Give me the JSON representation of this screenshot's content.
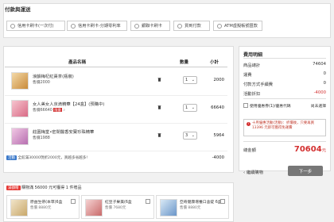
{
  "payment": {
    "title": "付款與運送",
    "options": [
      "信用卡刷卡(一次付)",
      "信用卡刷卡-分期零利率",
      "銀聯卡刷卡",
      "貨到付款",
      "ATM虛擬帳號匯款"
    ]
  },
  "table": {
    "headers": [
      "產品名稱",
      "數量",
      "小計"
    ]
  },
  "items": [
    {
      "name": "浪韻梅杞紅棗茶(瓶裝)",
      "info": "售價2000",
      "qty": "1",
      "subtotal": "2000",
      "tag": ""
    },
    {
      "name": "女人美女人京滴精華【24盒】(預購中)",
      "info": "售價66640",
      "qty": "1",
      "subtotal": "66640",
      "tag": "限量"
    },
    {
      "name": "莊園梅堂•密閉醫香安寶珍珠精華",
      "info": "售價1988",
      "qty": "3",
      "subtotal": "5964",
      "tag": ""
    }
  ],
  "promo_row": {
    "badge": "活動",
    "text": "全館滿30000現折2000元，買越多省越多!",
    "amount": "-4000"
  },
  "fee": {
    "title": "費用明細",
    "lines": [
      {
        "label": "商品總計",
        "value": "74604"
      },
      {
        "label": "運費",
        "value": "0"
      },
      {
        "label": "付款方式手續費",
        "value": "0"
      },
      {
        "label": "活動折扣",
        "value": "-4000"
      }
    ],
    "coupon_label": "使用優惠券(1)/優惠代碼",
    "coupon_link": "尚未選擇",
    "notice": "十月優惠活動(活動)：折價後，只要再買 13396 元即可獲得免運費",
    "total_label": "總金額",
    "total_value": "70604",
    "total_unit": "元"
  },
  "buttons": {
    "back": "繼續購物",
    "next": "下一步"
  },
  "bottom_promo": {
    "badge": "滿額贈",
    "title": "購物滿 56000 元可獲得 1 件贈品",
    "cards": [
      {
        "name": "原益生帶(本草)6盒",
        "price": "售價 8880元"
      },
      {
        "name": "紅豆子果美(6盒",
        "price": "售價 7680元"
      },
      {
        "name": "亞奇健康增養口含錠 6盒",
        "price": "售價 8880元"
      }
    ]
  },
  "colors": {
    "accent_red": "#e53935",
    "total_red": "#d32f2f",
    "next_button": "#777777",
    "badge_blue": "#3a78c9"
  }
}
